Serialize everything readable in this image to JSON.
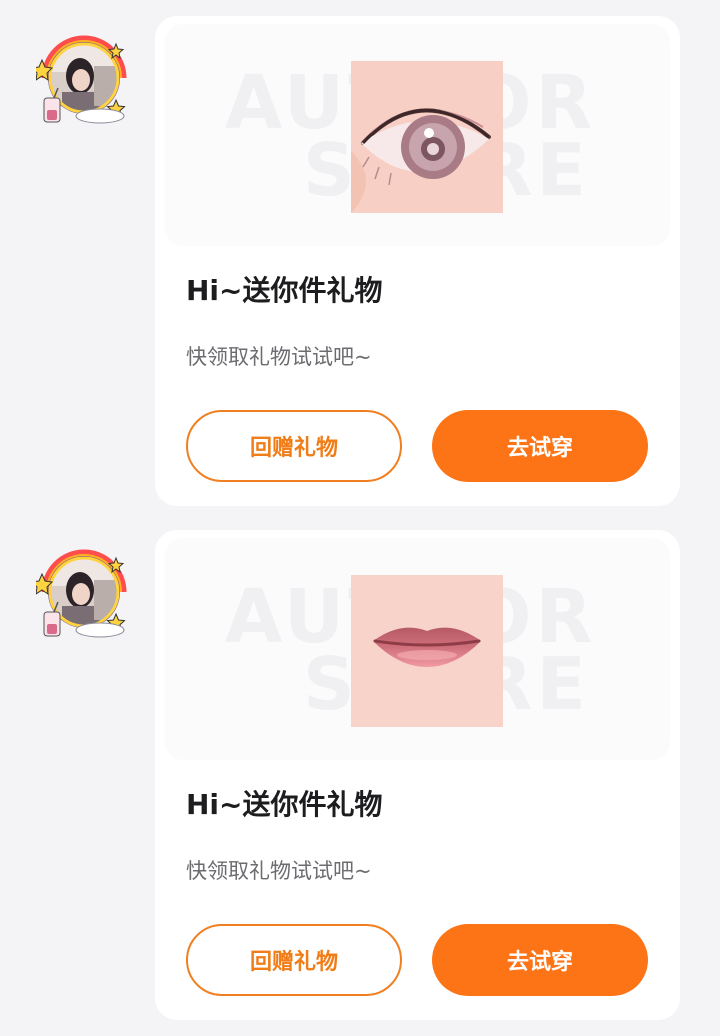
{
  "messages": [
    {
      "avatar_icon": "sender-avatar-frame-icon",
      "gift_image": "eye-makeup-preview",
      "watermark_line1": "AUTHOR",
      "watermark_line2": "STORE",
      "title": "Hi~送你件礼物",
      "subtitle": "快领取礼物试试吧~",
      "return_gift_label": "回赠礼物",
      "try_on_label": "去试穿"
    },
    {
      "avatar_icon": "sender-avatar-frame-icon",
      "gift_image": "lip-makeup-preview",
      "watermark_line1": "AUTHOR",
      "watermark_line2": "STORE",
      "title": "Hi~送你件礼物",
      "subtitle": "快领取礼物试试吧~",
      "return_gift_label": "回赠礼物",
      "try_on_label": "去试穿"
    }
  ],
  "colors": {
    "accent": "#fc7416",
    "accent_outline": "#f07f21",
    "background": "#f4f4f6",
    "card": "#ffffff"
  }
}
